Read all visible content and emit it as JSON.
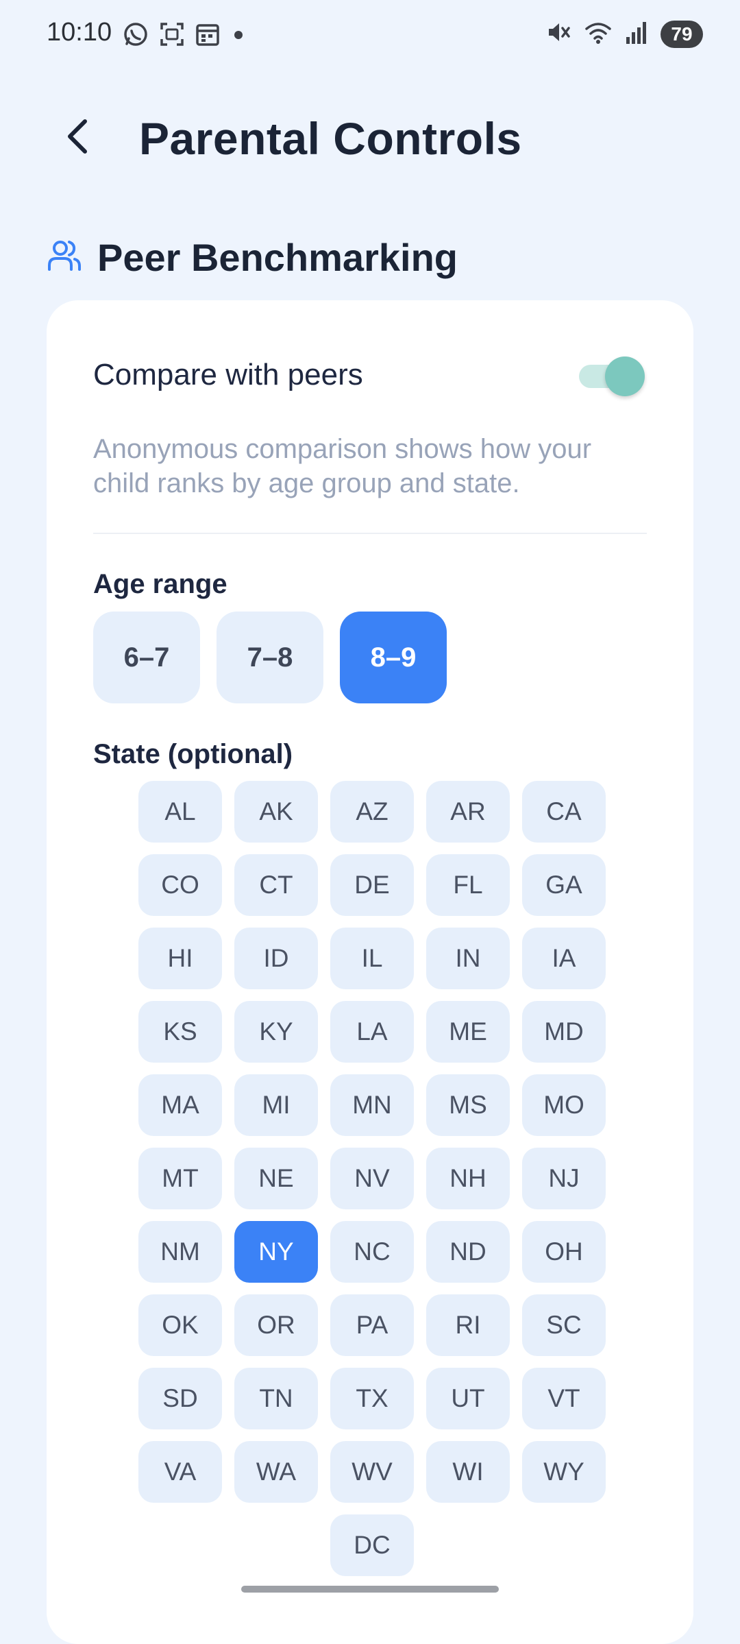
{
  "status_bar": {
    "time": "10:10",
    "battery": "79",
    "left_icons": [
      "whatsapp-icon",
      "screenshot-icon",
      "calendar-icon",
      "dot-icon"
    ],
    "right_icons": [
      "mute-icon",
      "wifi-icon",
      "signal-icon"
    ]
  },
  "header": {
    "title": "Parental Controls",
    "back_icon": "chevron-left-icon"
  },
  "section": {
    "title": "Peer Benchmarking",
    "icon": "users-icon"
  },
  "compare": {
    "label": "Compare with peers",
    "enabled": true,
    "description": "Anonymous comparison shows how your child ranks by age group and state."
  },
  "age": {
    "label": "Age range",
    "options": [
      "6–7",
      "7–8",
      "8–9"
    ],
    "selected": "8–9"
  },
  "state": {
    "label": "State (optional)",
    "options": [
      "AL",
      "AK",
      "AZ",
      "AR",
      "CA",
      "CO",
      "CT",
      "DE",
      "FL",
      "GA",
      "HI",
      "ID",
      "IL",
      "IN",
      "IA",
      "KS",
      "KY",
      "LA",
      "ME",
      "MD",
      "MA",
      "MI",
      "MN",
      "MS",
      "MO",
      "MT",
      "NE",
      "NV",
      "NH",
      "NJ",
      "NM",
      "NY",
      "NC",
      "ND",
      "OH",
      "OK",
      "OR",
      "PA",
      "RI",
      "SC",
      "SD",
      "TN",
      "TX",
      "UT",
      "VT",
      "VA",
      "WA",
      "WV",
      "WI",
      "WY",
      "DC"
    ],
    "selected": "NY"
  },
  "colors": {
    "background": "#EEF4FD",
    "accent": "#3B82F6",
    "chip": "#E6EFFB",
    "toggle_on": "#7CC8BE"
  }
}
